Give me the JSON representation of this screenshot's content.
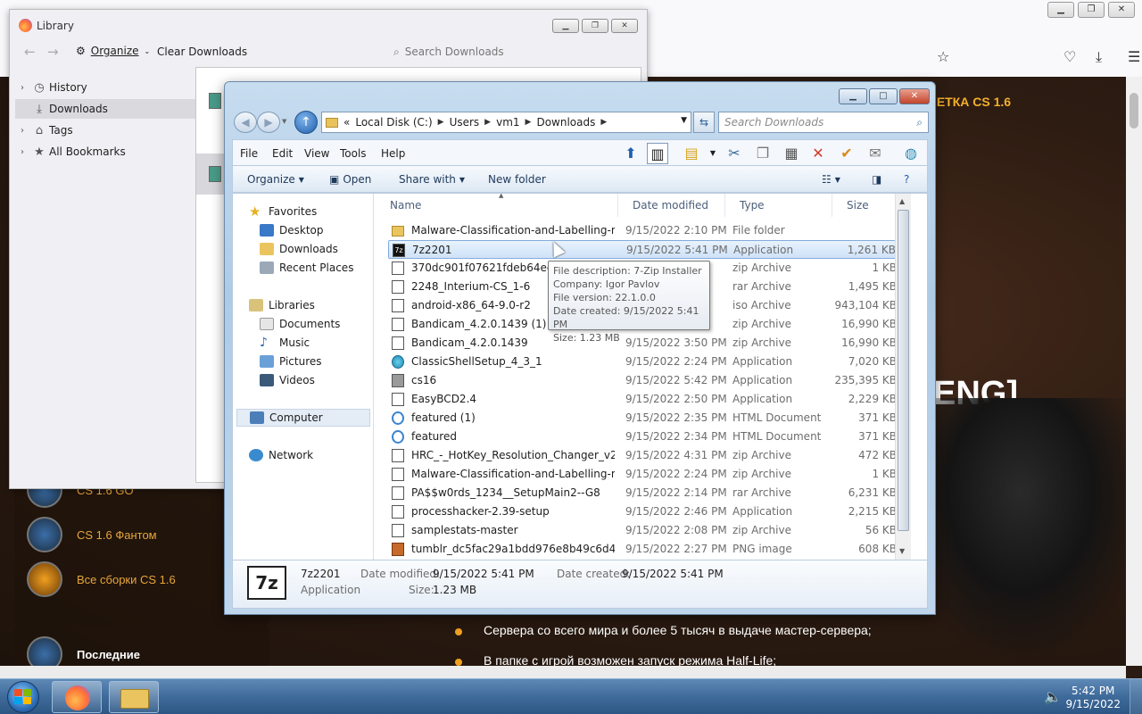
{
  "colors": {
    "accent": "#3f6b9b",
    "selection": "#cfe2f8",
    "site_orange": "#f5b02a"
  },
  "site": {
    "promo": "ЛЕТКА CS 1.6",
    "eng": "ENG]",
    "items": [
      "CS 1.6 GO",
      "CS 1.6 Фантом",
      "Все сборки CS 1.6"
    ],
    "bottom_title": "Последние",
    "bullets": [
      "Сервера со всего мира и более 5 тысяч в выдаче мастер-сервера;",
      "В папке с игрой возможен запуск режима Half-Life;"
    ]
  },
  "library": {
    "title": "Library",
    "organize": "Organize",
    "clear": "Clear Downloads",
    "search_placeholder": "Search Downloads",
    "sidebar": [
      "History",
      "Downloads",
      "Tags",
      "All Bookmarks"
    ]
  },
  "explorer": {
    "breadcrumb": {
      "prefix": "«",
      "parts": [
        "Local Disk (C:)",
        "Users",
        "vm1",
        "Downloads"
      ]
    },
    "search_placeholder": "Search Downloads",
    "menu": [
      "File",
      "Edit",
      "View",
      "Tools",
      "Help"
    ],
    "commands": {
      "organize": "Organize",
      "open": "Open",
      "share": "Share with",
      "new_folder": "New folder"
    },
    "nav": {
      "favorites": "Favorites",
      "fav_items": [
        "Desktop",
        "Downloads",
        "Recent Places"
      ],
      "libraries": "Libraries",
      "lib_items": [
        "Documents",
        "Music",
        "Pictures",
        "Videos"
      ],
      "computer": "Computer",
      "network": "Network"
    },
    "columns": {
      "name": "Name",
      "date": "Date modified",
      "type": "Type",
      "size": "Size"
    },
    "files": [
      {
        "name": "Malware-Classification-and-Labelling-m...",
        "date": "9/15/2022 2:10 PM",
        "type": "File folder",
        "size": ""
      },
      {
        "name": "7z2201",
        "date": "9/15/2022 5:41 PM",
        "type": "Application",
        "size": "1,261 KB"
      },
      {
        "name": "370dc901f07621fdeb64ed461d",
        "date": "",
        "type": "zip Archive",
        "size": "1 KB"
      },
      {
        "name": "2248_Interium-CS_1-6",
        "date": "",
        "type": "rar Archive",
        "size": "1,495 KB"
      },
      {
        "name": "android-x86_64-9.0-r2",
        "date": "",
        "type": "iso Archive",
        "size": "943,104 KB"
      },
      {
        "name": "Bandicam_4.2.0.1439 (1)",
        "date": "",
        "type": "zip Archive",
        "size": "16,990 KB"
      },
      {
        "name": "Bandicam_4.2.0.1439",
        "date": "9/15/2022 3:50 PM",
        "type": "zip Archive",
        "size": "16,990 KB"
      },
      {
        "name": "ClassicShellSetup_4_3_1",
        "date": "9/15/2022 2:24 PM",
        "type": "Application",
        "size": "7,020 KB"
      },
      {
        "name": "cs16",
        "date": "9/15/2022 5:42 PM",
        "type": "Application",
        "size": "235,395 KB"
      },
      {
        "name": "EasyBCD2.4",
        "date": "9/15/2022 2:50 PM",
        "type": "Application",
        "size": "2,229 KB"
      },
      {
        "name": "featured (1)",
        "date": "9/15/2022 2:35 PM",
        "type": "HTML Document",
        "size": "371 KB"
      },
      {
        "name": "featured",
        "date": "9/15/2022 2:34 PM",
        "type": "HTML Document",
        "size": "371 KB"
      },
      {
        "name": "HRC_-_HotKey_Resolution_Changer_v2_1...",
        "date": "9/15/2022 4:31 PM",
        "type": "zip Archive",
        "size": "472 KB"
      },
      {
        "name": "Malware-Classification-and-Labelling-m...",
        "date": "9/15/2022 2:24 PM",
        "type": "zip Archive",
        "size": "1 KB"
      },
      {
        "name": "PA$$w0rds_1234__SetupMain2--G8",
        "date": "9/15/2022 2:14 PM",
        "type": "rar Archive",
        "size": "6,231 KB"
      },
      {
        "name": "processhacker-2.39-setup",
        "date": "9/15/2022 2:46 PM",
        "type": "Application",
        "size": "2,215 KB"
      },
      {
        "name": "samplestats-master",
        "date": "9/15/2022 2:08 PM",
        "type": "zip Archive",
        "size": "56 KB"
      },
      {
        "name": "tumblr_dc5fac29a1bdd976e8b49c6d4fd1...",
        "date": "9/15/2022 2:27 PM",
        "type": "PNG image",
        "size": "608 KB"
      }
    ],
    "tooltip": [
      "File description: 7-Zip Installer",
      "Company: Igor Pavlov",
      "File version: 22.1.0.0",
      "Date created: 9/15/2022 5:41 PM",
      "Size: 1.23 MB"
    ],
    "details": {
      "name": "7z2201",
      "kind": "Application",
      "modified_label": "Date modified:",
      "modified": "9/15/2022 5:41 PM",
      "created_label": "Date created:",
      "created": "9/15/2022 5:41 PM",
      "size_label": "Size:",
      "size": "1.23 MB",
      "icon_text": "7z"
    }
  },
  "taskbar": {
    "time": "5:42 PM",
    "date": "9/15/2022"
  }
}
